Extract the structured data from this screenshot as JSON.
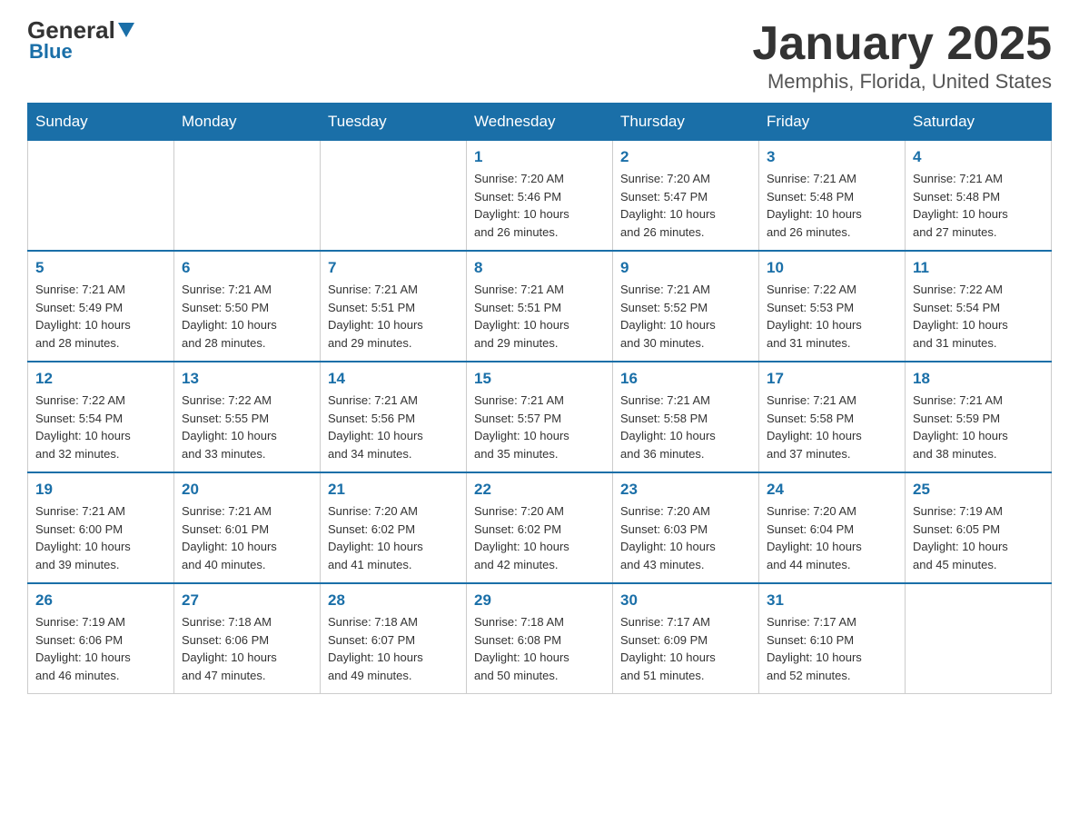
{
  "header": {
    "logo_general": "General",
    "logo_blue": "Blue",
    "title": "January 2025",
    "subtitle": "Memphis, Florida, United States"
  },
  "days_of_week": [
    "Sunday",
    "Monday",
    "Tuesday",
    "Wednesday",
    "Thursday",
    "Friday",
    "Saturday"
  ],
  "weeks": [
    [
      {
        "day": "",
        "info": ""
      },
      {
        "day": "",
        "info": ""
      },
      {
        "day": "",
        "info": ""
      },
      {
        "day": "1",
        "info": "Sunrise: 7:20 AM\nSunset: 5:46 PM\nDaylight: 10 hours\nand 26 minutes."
      },
      {
        "day": "2",
        "info": "Sunrise: 7:20 AM\nSunset: 5:47 PM\nDaylight: 10 hours\nand 26 minutes."
      },
      {
        "day": "3",
        "info": "Sunrise: 7:21 AM\nSunset: 5:48 PM\nDaylight: 10 hours\nand 26 minutes."
      },
      {
        "day": "4",
        "info": "Sunrise: 7:21 AM\nSunset: 5:48 PM\nDaylight: 10 hours\nand 27 minutes."
      }
    ],
    [
      {
        "day": "5",
        "info": "Sunrise: 7:21 AM\nSunset: 5:49 PM\nDaylight: 10 hours\nand 28 minutes."
      },
      {
        "day": "6",
        "info": "Sunrise: 7:21 AM\nSunset: 5:50 PM\nDaylight: 10 hours\nand 28 minutes."
      },
      {
        "day": "7",
        "info": "Sunrise: 7:21 AM\nSunset: 5:51 PM\nDaylight: 10 hours\nand 29 minutes."
      },
      {
        "day": "8",
        "info": "Sunrise: 7:21 AM\nSunset: 5:51 PM\nDaylight: 10 hours\nand 29 minutes."
      },
      {
        "day": "9",
        "info": "Sunrise: 7:21 AM\nSunset: 5:52 PM\nDaylight: 10 hours\nand 30 minutes."
      },
      {
        "day": "10",
        "info": "Sunrise: 7:22 AM\nSunset: 5:53 PM\nDaylight: 10 hours\nand 31 minutes."
      },
      {
        "day": "11",
        "info": "Sunrise: 7:22 AM\nSunset: 5:54 PM\nDaylight: 10 hours\nand 31 minutes."
      }
    ],
    [
      {
        "day": "12",
        "info": "Sunrise: 7:22 AM\nSunset: 5:54 PM\nDaylight: 10 hours\nand 32 minutes."
      },
      {
        "day": "13",
        "info": "Sunrise: 7:22 AM\nSunset: 5:55 PM\nDaylight: 10 hours\nand 33 minutes."
      },
      {
        "day": "14",
        "info": "Sunrise: 7:21 AM\nSunset: 5:56 PM\nDaylight: 10 hours\nand 34 minutes."
      },
      {
        "day": "15",
        "info": "Sunrise: 7:21 AM\nSunset: 5:57 PM\nDaylight: 10 hours\nand 35 minutes."
      },
      {
        "day": "16",
        "info": "Sunrise: 7:21 AM\nSunset: 5:58 PM\nDaylight: 10 hours\nand 36 minutes."
      },
      {
        "day": "17",
        "info": "Sunrise: 7:21 AM\nSunset: 5:58 PM\nDaylight: 10 hours\nand 37 minutes."
      },
      {
        "day": "18",
        "info": "Sunrise: 7:21 AM\nSunset: 5:59 PM\nDaylight: 10 hours\nand 38 minutes."
      }
    ],
    [
      {
        "day": "19",
        "info": "Sunrise: 7:21 AM\nSunset: 6:00 PM\nDaylight: 10 hours\nand 39 minutes."
      },
      {
        "day": "20",
        "info": "Sunrise: 7:21 AM\nSunset: 6:01 PM\nDaylight: 10 hours\nand 40 minutes."
      },
      {
        "day": "21",
        "info": "Sunrise: 7:20 AM\nSunset: 6:02 PM\nDaylight: 10 hours\nand 41 minutes."
      },
      {
        "day": "22",
        "info": "Sunrise: 7:20 AM\nSunset: 6:02 PM\nDaylight: 10 hours\nand 42 minutes."
      },
      {
        "day": "23",
        "info": "Sunrise: 7:20 AM\nSunset: 6:03 PM\nDaylight: 10 hours\nand 43 minutes."
      },
      {
        "day": "24",
        "info": "Sunrise: 7:20 AM\nSunset: 6:04 PM\nDaylight: 10 hours\nand 44 minutes."
      },
      {
        "day": "25",
        "info": "Sunrise: 7:19 AM\nSunset: 6:05 PM\nDaylight: 10 hours\nand 45 minutes."
      }
    ],
    [
      {
        "day": "26",
        "info": "Sunrise: 7:19 AM\nSunset: 6:06 PM\nDaylight: 10 hours\nand 46 minutes."
      },
      {
        "day": "27",
        "info": "Sunrise: 7:18 AM\nSunset: 6:06 PM\nDaylight: 10 hours\nand 47 minutes."
      },
      {
        "day": "28",
        "info": "Sunrise: 7:18 AM\nSunset: 6:07 PM\nDaylight: 10 hours\nand 49 minutes."
      },
      {
        "day": "29",
        "info": "Sunrise: 7:18 AM\nSunset: 6:08 PM\nDaylight: 10 hours\nand 50 minutes."
      },
      {
        "day": "30",
        "info": "Sunrise: 7:17 AM\nSunset: 6:09 PM\nDaylight: 10 hours\nand 51 minutes."
      },
      {
        "day": "31",
        "info": "Sunrise: 7:17 AM\nSunset: 6:10 PM\nDaylight: 10 hours\nand 52 minutes."
      },
      {
        "day": "",
        "info": ""
      }
    ]
  ]
}
